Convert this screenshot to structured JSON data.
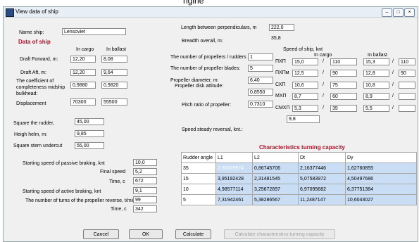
{
  "topbar": {
    "text": "ngine"
  },
  "window": {
    "title": "View data of ship",
    "min": "–",
    "max": "□",
    "close": "×"
  },
  "ship": {
    "label": "Name ship:",
    "value": "Lensoviet"
  },
  "section_title": "Data of ship",
  "headers": {
    "cargo": "In cargo",
    "ballast": "In ballast"
  },
  "draft_forward": {
    "label": "Draft Forward, m:",
    "cargo": "12,20",
    "ballast": "8,08"
  },
  "draft_aft": {
    "label": "Draft Aft, m:",
    "cargo": "12,20",
    "ballast": "9,64"
  },
  "completeness": {
    "label": "The coefficient of completeness midship bulkhead:",
    "cargo": "0,9880",
    "ballast": "0,9820"
  },
  "displacement": {
    "label": "Displacement",
    "cargo": "70300",
    "ballast": "55500"
  },
  "length": {
    "label": "Length between perpendiculars, m",
    "value": "222,0"
  },
  "breadth": {
    "label": "Breadth overall, m:",
    "value": "35,8"
  },
  "speed": {
    "title": "Speed of ship, knt",
    "cargo": "In cargo",
    "ballast": "In ballast",
    "rows": [
      {
        "code": "ПХП",
        "c1": "15,0",
        "c2": "110",
        "b1": "15,3",
        "b2": "110"
      },
      {
        "code": "ПХПм",
        "c1": "12,5",
        "c2": "90",
        "b1": "12,8",
        "b2": "90"
      },
      {
        "code": "СХП",
        "c1": "10,6",
        "c2": "75",
        "b1": "10,8",
        "b2": ""
      },
      {
        "code": "МХП",
        "c1": "8,7",
        "c2": "60",
        "b1": "8,9",
        "b2": ""
      },
      {
        "code": "СМХП",
        "c1": "5,3",
        "c2": "35",
        "b1": "5,5",
        "b2": ""
      }
    ],
    "slash": "/"
  },
  "props_count": {
    "label": "The number of propellers / rudders :",
    "value": "1"
  },
  "blades": {
    "label": "The number of propeller blades:",
    "value": "5"
  },
  "prop_diameter": {
    "label": "Propeller diameter, m:",
    "value": "6,40"
  },
  "disk_attitude": {
    "label": "Propeller disk attitude:",
    "value": "0,8550"
  },
  "pitch": {
    "label": "Pitch ratio of propeller:",
    "value": "0,7310"
  },
  "rudder_square": {
    "label": "Square the rudder,",
    "value": "45,00"
  },
  "heigh_helm": {
    "label": "Heigh helm, m:",
    "value": "9,85"
  },
  "stern_undercut": {
    "label": "Square stern undercut",
    "value": "55,00"
  },
  "steady_reversal": {
    "label": "Speed steady reversal, knt.:",
    "value": "9,8"
  },
  "passive": {
    "label": "Starting speed of passive braking, knt",
    "value": "10,0",
    "final_label": "Final speed",
    "final_value": "5,2",
    "time_label": "Time, c",
    "time_value": "672"
  },
  "active": {
    "label": "Starting speed of active braking, knt",
    "value": "9,1",
    "turns_label": "The number of turns of the propeller reverse, t/min:",
    "turns_value": "99",
    "time_label": "Time, c",
    "time_value": "342"
  },
  "turning": {
    "title": "Characteristics turning capacity",
    "headers": [
      "Rudder angle",
      "L1",
      "L2",
      "Dt",
      "Dy"
    ],
    "rows": [
      [
        "35",
        "2,36329974",
        "0,86745706",
        "2,16377446",
        "1,62760855"
      ],
      [
        "15",
        "3,95192428",
        "2,31481545",
        "5,07583972",
        "4,50497686"
      ],
      [
        "10",
        "4,98577114",
        "3,25672897",
        "6,97095682",
        "6,37751384"
      ],
      [
        "5",
        "7,31942461",
        "5,38286567",
        "11,2487147",
        "10,6043027"
      ]
    ]
  },
  "buttons": {
    "cancel": "Cancel",
    "ok": "OK",
    "calculate": "Calculate",
    "calc_turning": "Calculate characteristics turning capacity"
  },
  "colors": {
    "accent": "#3b7fd0",
    "section": "#b0122a"
  }
}
